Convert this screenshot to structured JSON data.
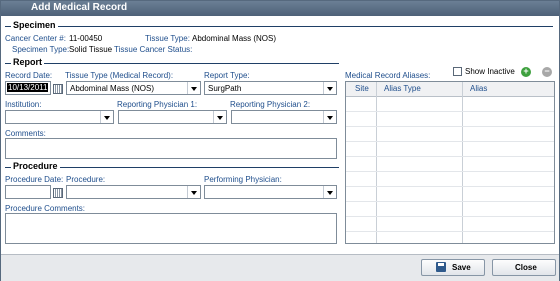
{
  "window": {
    "title": "Add Medical Record"
  },
  "specimen": {
    "section_title": "Specimen",
    "cancer_center_label": "Cancer Center #:",
    "cancer_center_value": "11-00450",
    "tissue_type_label": "Tissue Type:",
    "tissue_type_value": "Abdominal Mass (NOS)",
    "specimen_type_label": "Specimen Type:",
    "specimen_type_value": "Solid Tissue",
    "tissue_cancer_status_label": "Tissue Cancer Status:"
  },
  "report": {
    "section_title": "Report",
    "record_date_label": "Record Date:",
    "record_date_value": "10/13/2011",
    "tissue_type_label": "Tissue Type (Medical Record):",
    "tissue_type_value": "Abdominal Mass (NOS)",
    "report_type_label": "Report Type:",
    "report_type_value": "SurgPath",
    "institution_label": "Institution:",
    "reporting_physician_1_label": "Reporting Physician 1:",
    "reporting_physician_2_label": "Reporting Physician 2:",
    "comments_label": "Comments:"
  },
  "procedure": {
    "section_title": "Procedure",
    "procedure_date_label": "Procedure Date:",
    "procedure_label": "Procedure:",
    "performing_physician_label": "Performing Physician:",
    "procedure_comments_label": "Procedure Comments:"
  },
  "aliases": {
    "label": "Medical Record Aliases:",
    "show_inactive_label": "Show Inactive",
    "add_icon": "add-icon",
    "remove_icon": "remove-icon",
    "columns": [
      "Site",
      "Alias Type",
      "Alias"
    ]
  },
  "footer": {
    "save_label": "Save",
    "close_label": "Close"
  },
  "colors": {
    "label_blue": "#1f4e8c",
    "title_bar": "#5a6d84",
    "add_green": "#3ea03e",
    "remove_gray": "#a8a8a8"
  }
}
